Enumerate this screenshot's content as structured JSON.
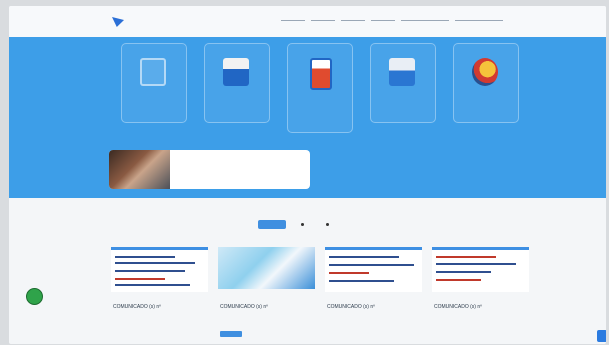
{
  "header": {
    "logo_text": "",
    "nav": [
      "",
      "",
      "",
      "",
      "",
      ""
    ]
  },
  "hero": {
    "cards": [
      {
        "icon": "document-icon",
        "label": ""
      },
      {
        "icon": "office-icon",
        "label": ""
      },
      {
        "icon": "phone-icon",
        "label": ""
      },
      {
        "icon": "chart-icon",
        "label": ""
      },
      {
        "icon": "gear-star-icon",
        "label": ""
      }
    ],
    "panel_text": ""
  },
  "filters": [
    {
      "label": "",
      "active": true
    },
    {
      "label": "",
      "active": false
    },
    {
      "label": "",
      "active": false
    }
  ],
  "news": [
    {
      "title": "COMUNICADO (s) nº",
      "date": ""
    },
    {
      "title": "COMUNICADO (s) nº",
      "date": ""
    },
    {
      "title": "COMUNICADO (s) nº",
      "date": ""
    },
    {
      "title": "COMUNICADO (s) nº",
      "date": ""
    }
  ],
  "colors": {
    "hero": "#3d9ee8",
    "accent": "#3f8fe0",
    "status": "#2fa34a"
  }
}
